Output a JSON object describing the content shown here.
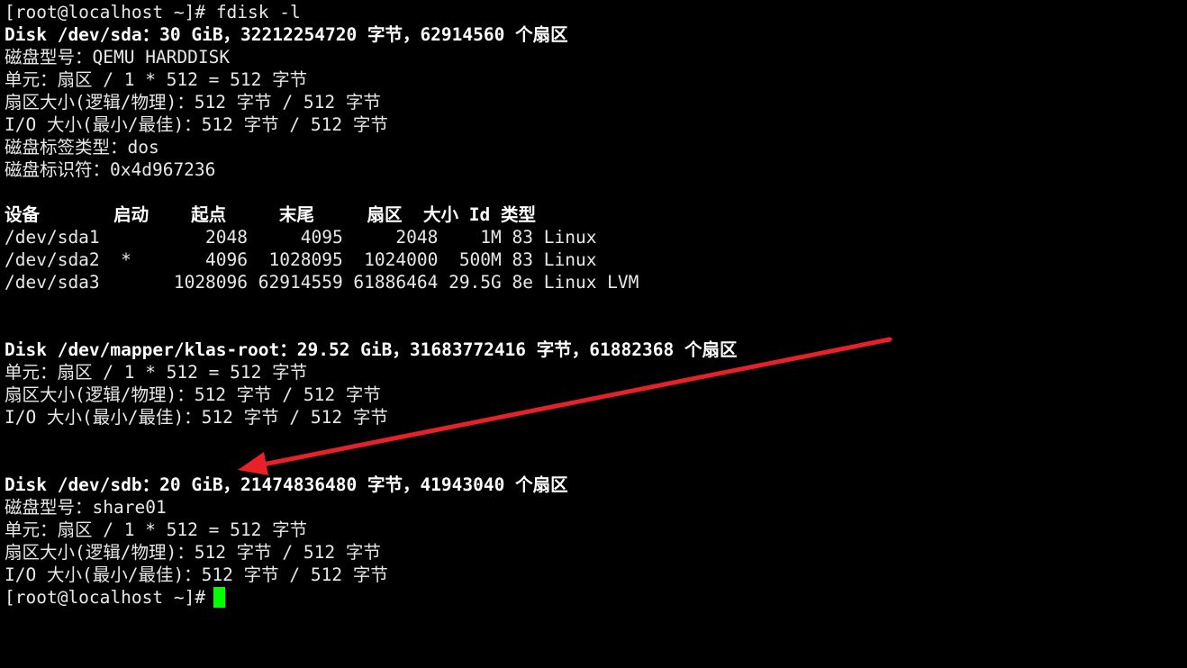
{
  "terminal": {
    "prompt": "[root@localhost ~]# ",
    "command": "fdisk -l",
    "disk1": {
      "header": "Disk /dev/sda：30 GiB，32212254720 字节，62914560 个扇区",
      "model": "磁盘型号：QEMU HARDDISK",
      "units": "单元：扇区 / 1 * 512 = 512 字节",
      "sector_size": "扇区大小(逻辑/物理)：512 字节 / 512 字节",
      "io_size": "I/O 大小(最小/最佳)：512 字节 / 512 字节",
      "label_type": "磁盘标签类型：dos",
      "identifier": "磁盘标识符：0x4d967236",
      "table_header": "设备       启动    起点     末尾     扇区  大小 Id 类型",
      "rows": [
        "/dev/sda1          2048     4095     2048    1M 83 Linux",
        "/dev/sda2  *       4096  1028095  1024000  500M 83 Linux",
        "/dev/sda3       1028096 62914559 61886464 29.5G 8e Linux LVM"
      ]
    },
    "disk2": {
      "header": "Disk /dev/mapper/klas-root：29.52 GiB，31683772416 字节，61882368 个扇区",
      "units": "单元：扇区 / 1 * 512 = 512 字节",
      "sector_size": "扇区大小(逻辑/物理)：512 字节 / 512 字节",
      "io_size": "I/O 大小(最小/最佳)：512 字节 / 512 字节"
    },
    "disk3": {
      "header": "Disk /dev/sdb：20 GiB，21474836480 字节，41943040 个扇区",
      "model": "磁盘型号：share01",
      "units": "单元：扇区 / 1 * 512 = 512 字节",
      "sector_size": "扇区大小(逻辑/物理)：512 字节 / 512 字节",
      "io_size": "I/O 大小(最小/最佳)：512 字节 / 512 字节"
    },
    "final_prompt": "[root@localhost ~]#"
  },
  "colors": {
    "background": "#000000",
    "text": "#e8e8e8",
    "cursor": "#00ff00",
    "annotation_arrow": "#e8202a"
  },
  "annotation": {
    "type": "arrow",
    "points_to": "disk3-header"
  }
}
